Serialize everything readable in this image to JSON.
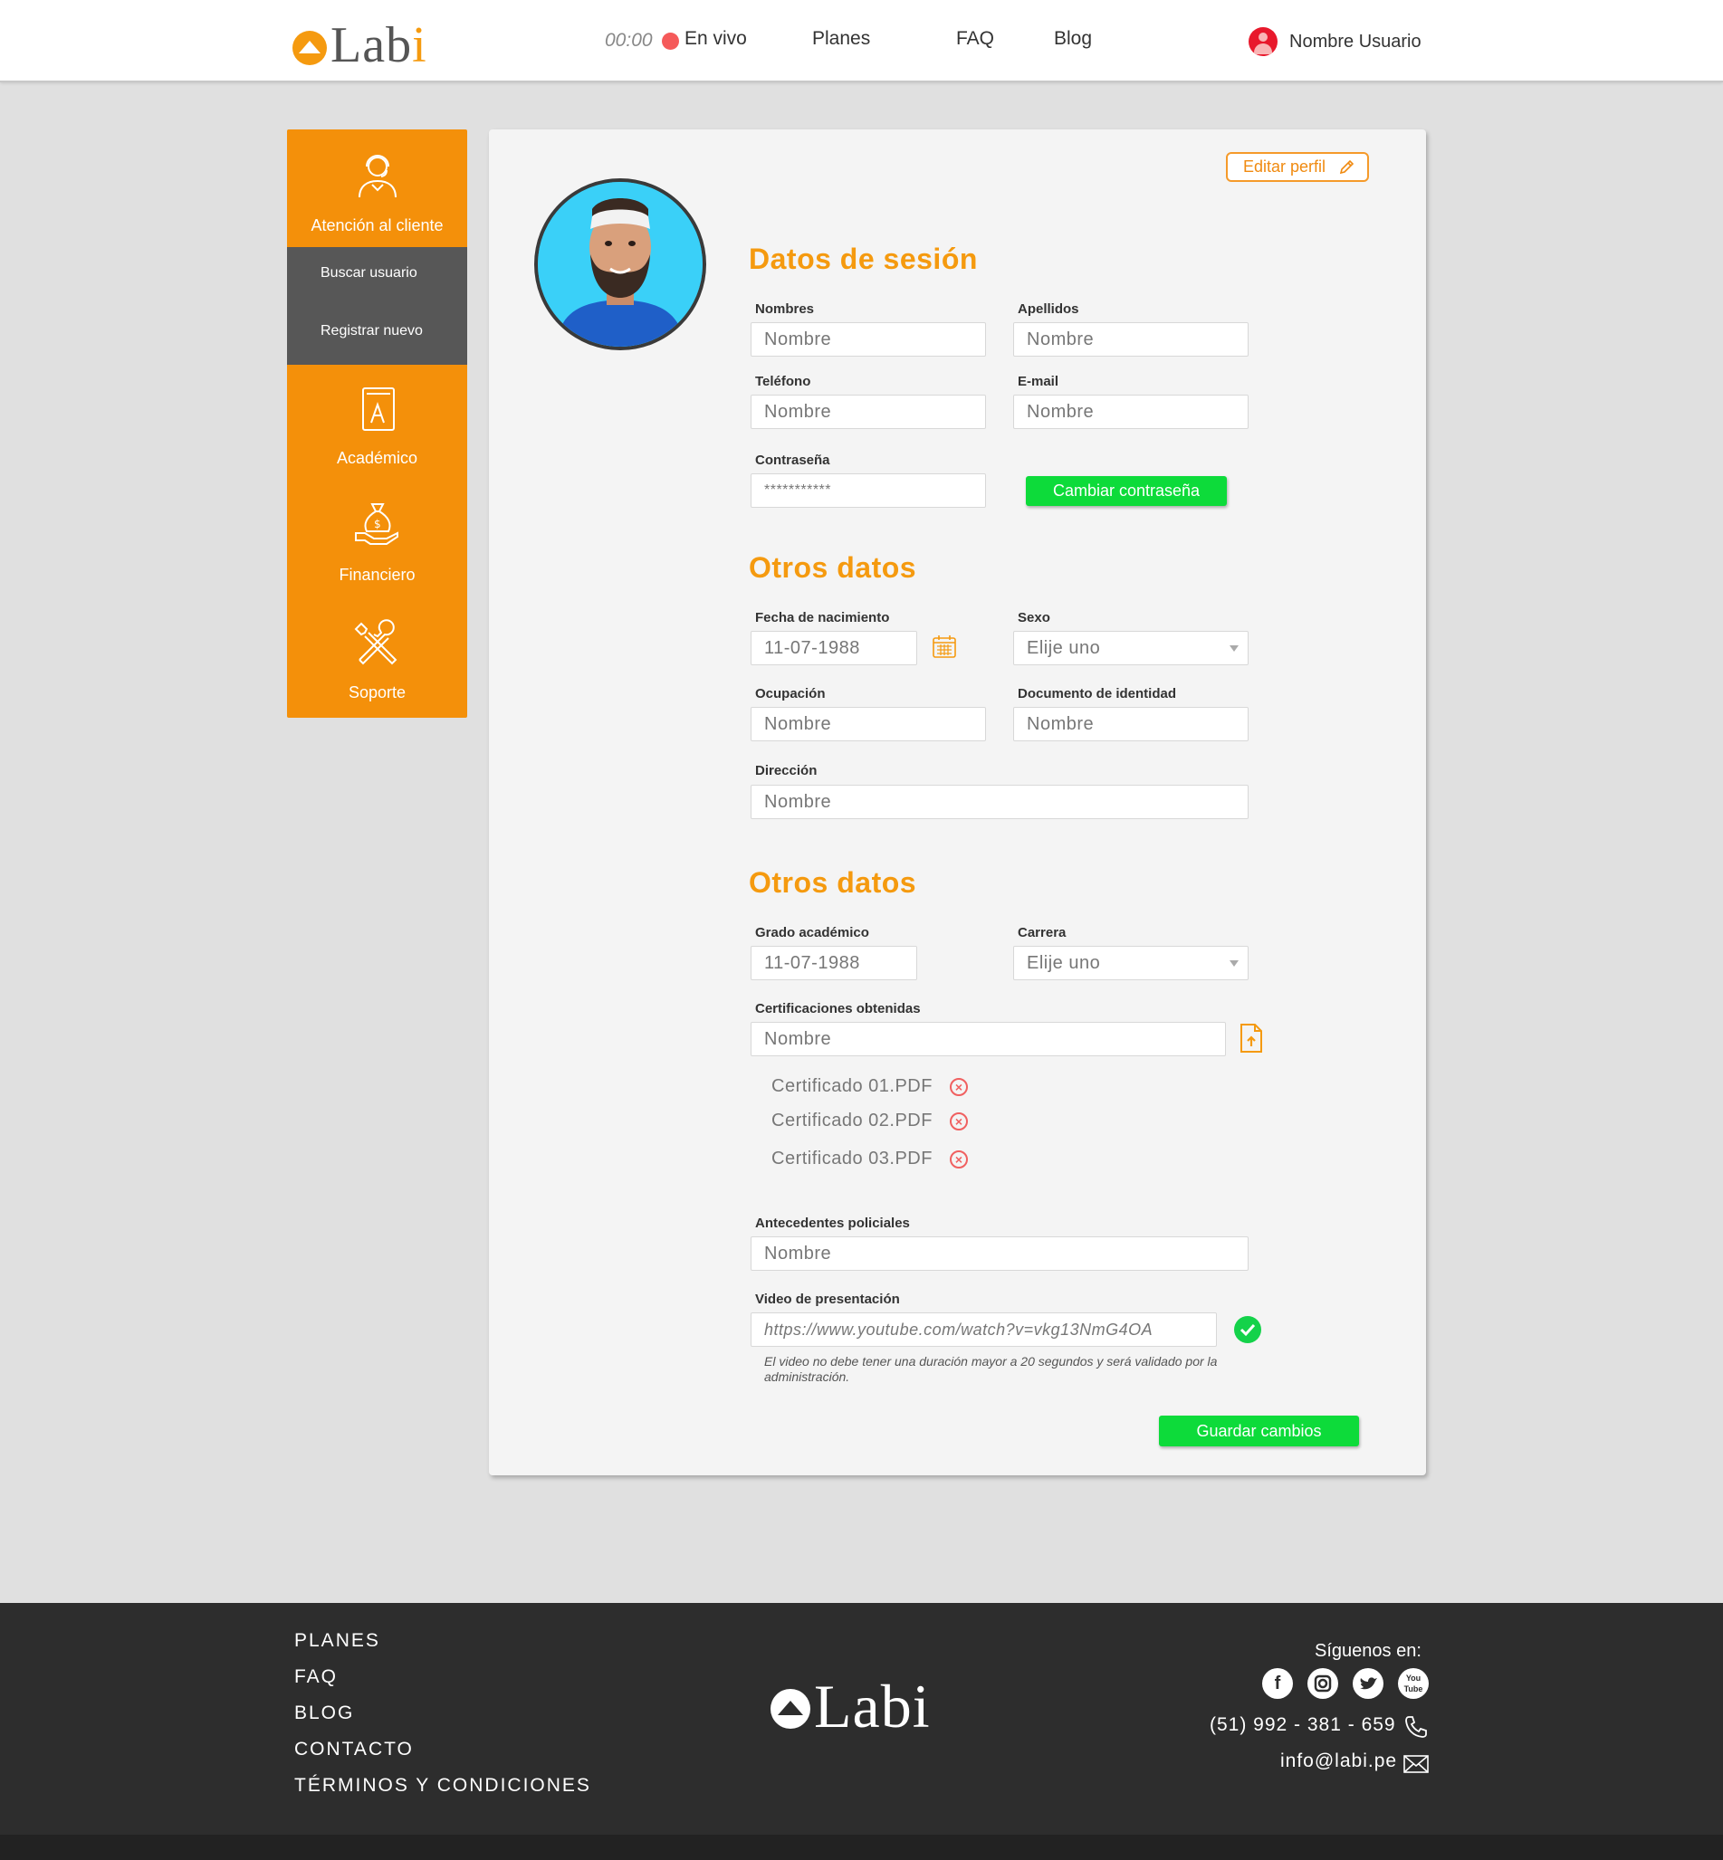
{
  "brand": {
    "name_main": "Lab",
    "name_accent": "i",
    "accent_color": "#f59a0f"
  },
  "header": {
    "live_time": "00:00",
    "live_label": "En vivo",
    "nav": [
      "Planes",
      "FAQ",
      "Blog"
    ],
    "user_name": "Nombre Usuario"
  },
  "sidebar": {
    "items": [
      {
        "label": "Atención al cliente",
        "icon": "customer-support-icon"
      },
      {
        "label": "Académico",
        "icon": "book-icon"
      },
      {
        "label": "Financiero",
        "icon": "money-bag-icon"
      },
      {
        "label": "Soporte",
        "icon": "tools-icon"
      }
    ],
    "sub_items": [
      "Buscar usuario",
      "Registrar nuevo"
    ]
  },
  "profile": {
    "edit_label": "Editar perfil",
    "session": {
      "title": "Datos de sesión",
      "nombres_label": "Nombres",
      "nombres_placeholder": "Nombre",
      "apellidos_label": "Apellidos",
      "apellidos_placeholder": "Nombre",
      "telefono_label": "Teléfono",
      "telefono_placeholder": "Nombre",
      "email_label": "E-mail",
      "email_placeholder": "Nombre",
      "password_label": "Contraseña",
      "password_value": "***********",
      "change_password_label": "Cambiar contraseña"
    },
    "other": {
      "title": "Otros datos",
      "birth_label": "Fecha de nacimiento",
      "birth_value": "11-07-1988",
      "sex_label": "Sexo",
      "sex_value": "Elije uno",
      "occupation_label": "Ocupación",
      "occupation_placeholder": "Nombre",
      "id_label": "Documento de identidad",
      "id_placeholder": "Nombre",
      "address_label": "Dirección",
      "address_placeholder": "Nombre"
    },
    "academic": {
      "title": "Otros datos",
      "degree_label": "Grado académico",
      "degree_value": "11-07-1988",
      "career_label": "Carrera",
      "career_value": "Elije uno",
      "certs_label": "Certificaciones obtenidas",
      "certs_placeholder": "Nombre",
      "certificates": [
        "Certificado 01.PDF",
        "Certificado 02.PDF",
        "Certificado 03.PDF"
      ],
      "police_label": "Antecedentes policiales",
      "police_placeholder": "Nombre",
      "video_label": "Video de presentación",
      "video_value": "https://www.youtube.com/watch?v=vkg13NmG4OA",
      "video_note": "El video no debe tener una duración mayor a 20 segundos y será validado por la administración."
    },
    "save_label": "Guardar cambios"
  },
  "footer": {
    "links": [
      "PLANES",
      "FAQ",
      "BLOG",
      "CONTACTO",
      "TÉRMINOS Y CONDICIONES"
    ],
    "follow_label": "Síguenos en:",
    "social": [
      "facebook-icon",
      "instagram-icon",
      "twitter-icon",
      "youtube-icon"
    ],
    "phone": "(51) 992 - 381 - 659",
    "email": "info@labi.pe"
  }
}
